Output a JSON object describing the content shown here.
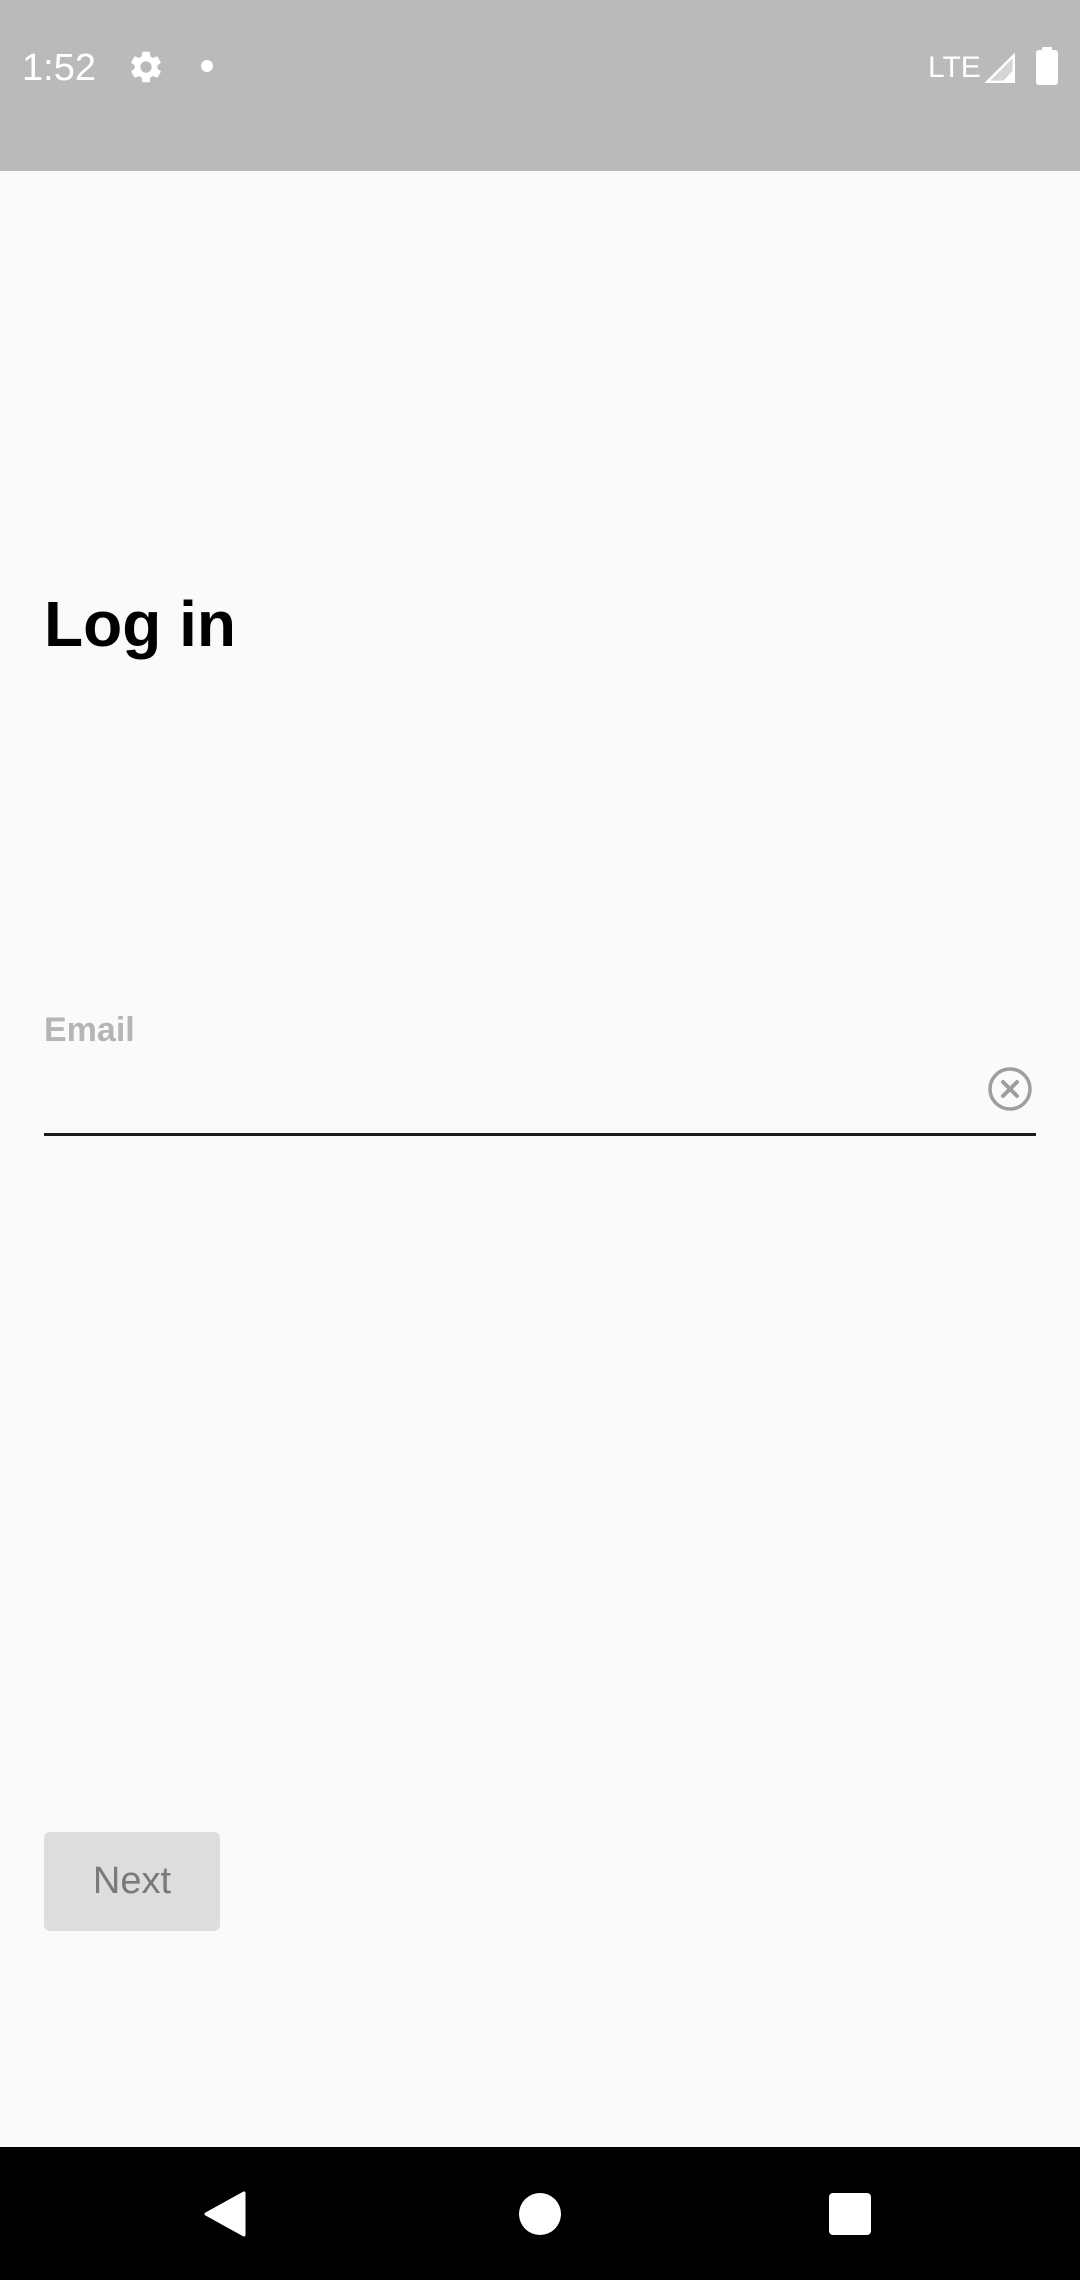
{
  "status_bar": {
    "time": "1:52",
    "network": "LTE",
    "icons": [
      "gear-icon",
      "notification-dot-icon",
      "signal-icon",
      "battery-icon"
    ],
    "background_color": "#bababa"
  },
  "login": {
    "title": "Log in",
    "email_label": "Email",
    "email_value": "",
    "clear_icon": "clear-circle-icon",
    "next_label": "Next",
    "next_enabled": false
  },
  "nav_bar": {
    "icons": [
      "back-icon",
      "home-icon",
      "recents-icon"
    ]
  },
  "colors": {
    "background": "#fafafa",
    "label": "#b5b5b5",
    "button_disabled_bg": "#dddddd",
    "button_disabled_text": "#7a7a7a"
  }
}
